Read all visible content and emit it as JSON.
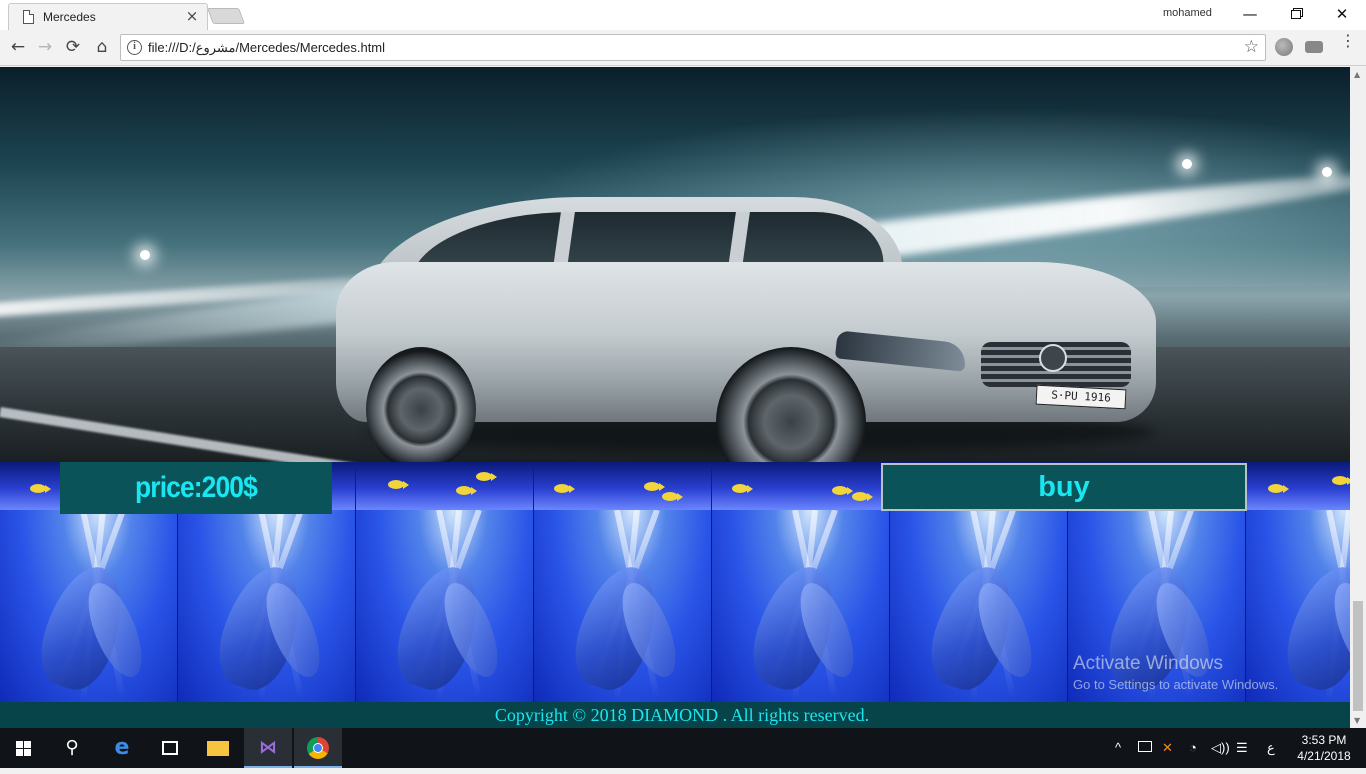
{
  "browser": {
    "tab_title": "Mercedes",
    "tab_close": "×",
    "user_name": "mohamed",
    "window_min": "—",
    "window_close": "✕",
    "url": "file:///D:/مشروع/Mercedes/Mercedes.html",
    "nav_back": "←",
    "nav_forward": "→",
    "nav_reload": "⟳",
    "nav_home": "⌂",
    "info": "i",
    "star": "☆",
    "menu": "⋮"
  },
  "page": {
    "plate": "S·PU 1916",
    "price": "price:200$",
    "buy_label": "buy",
    "footer": "Copyright © 2018 DIAMOND . All rights reserved."
  },
  "watermark": {
    "title": "Activate Windows",
    "subtitle": "Go to Settings to activate Windows."
  },
  "taskbar": {
    "search": "⚲",
    "lang": "ع",
    "time": "3:53 PM",
    "date": "4/21/2018"
  },
  "colors": {
    "accent_text": "#19e6f0",
    "panel": "#0a5358",
    "footer_bg": "#06444a"
  }
}
